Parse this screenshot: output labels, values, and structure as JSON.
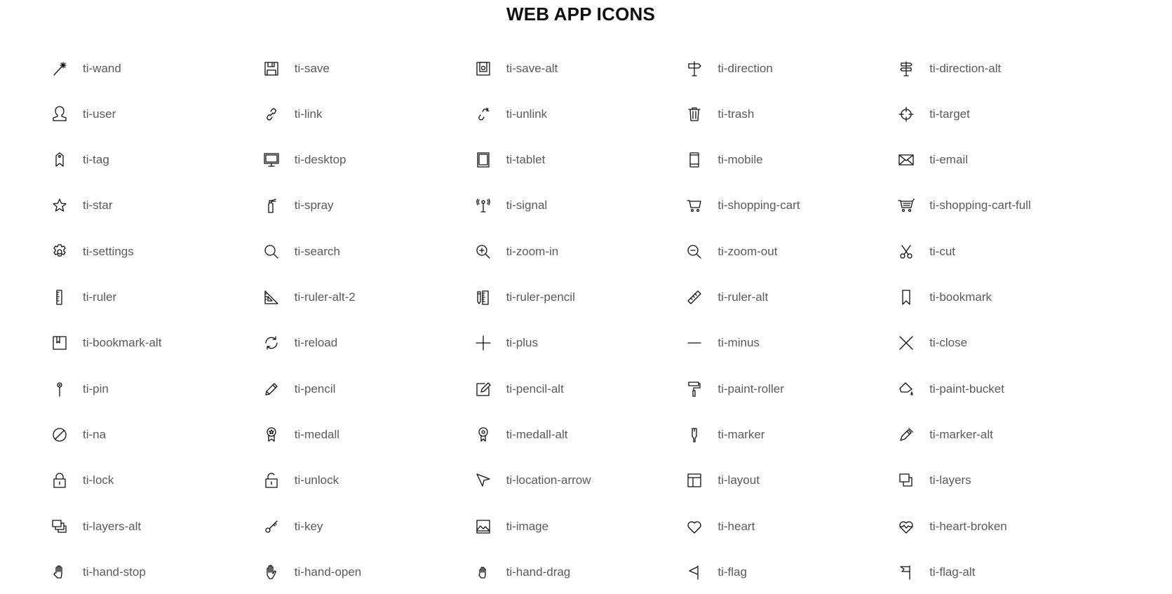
{
  "page": {
    "title": "WEB APP ICONS"
  },
  "icons": [
    {
      "label": "ti-wand",
      "icon": "wand-icon"
    },
    {
      "label": "ti-save",
      "icon": "save-icon"
    },
    {
      "label": "ti-save-alt",
      "icon": "save-alt-icon"
    },
    {
      "label": "ti-direction",
      "icon": "direction-icon"
    },
    {
      "label": "ti-direction-alt",
      "icon": "direction-alt-icon"
    },
    {
      "label": "ti-user",
      "icon": "user-icon"
    },
    {
      "label": "ti-link",
      "icon": "link-icon"
    },
    {
      "label": "ti-unlink",
      "icon": "unlink-icon"
    },
    {
      "label": "ti-trash",
      "icon": "trash-icon"
    },
    {
      "label": "ti-target",
      "icon": "target-icon"
    },
    {
      "label": "ti-tag",
      "icon": "tag-icon"
    },
    {
      "label": "ti-desktop",
      "icon": "desktop-icon"
    },
    {
      "label": "ti-tablet",
      "icon": "tablet-icon"
    },
    {
      "label": "ti-mobile",
      "icon": "mobile-icon"
    },
    {
      "label": "ti-email",
      "icon": "email-icon"
    },
    {
      "label": "ti-star",
      "icon": "star-icon"
    },
    {
      "label": "ti-spray",
      "icon": "spray-icon"
    },
    {
      "label": "ti-signal",
      "icon": "signal-icon"
    },
    {
      "label": "ti-shopping-cart",
      "icon": "shopping-cart-icon"
    },
    {
      "label": "ti-shopping-cart-full",
      "icon": "shopping-cart-full-icon"
    },
    {
      "label": "ti-settings",
      "icon": "settings-icon"
    },
    {
      "label": "ti-search",
      "icon": "search-icon"
    },
    {
      "label": "ti-zoom-in",
      "icon": "zoom-in-icon"
    },
    {
      "label": "ti-zoom-out",
      "icon": "zoom-out-icon"
    },
    {
      "label": "ti-cut",
      "icon": "cut-icon"
    },
    {
      "label": "ti-ruler",
      "icon": "ruler-icon"
    },
    {
      "label": "ti-ruler-alt-2",
      "icon": "ruler-alt-2-icon"
    },
    {
      "label": "ti-ruler-pencil",
      "icon": "ruler-pencil-icon"
    },
    {
      "label": "ti-ruler-alt",
      "icon": "ruler-alt-icon"
    },
    {
      "label": "ti-bookmark",
      "icon": "bookmark-icon"
    },
    {
      "label": "ti-bookmark-alt",
      "icon": "bookmark-alt-icon"
    },
    {
      "label": "ti-reload",
      "icon": "reload-icon"
    },
    {
      "label": "ti-plus",
      "icon": "plus-icon"
    },
    {
      "label": "ti-minus",
      "icon": "minus-icon"
    },
    {
      "label": "ti-close",
      "icon": "close-icon"
    },
    {
      "label": "ti-pin",
      "icon": "pin-icon"
    },
    {
      "label": "ti-pencil",
      "icon": "pencil-icon"
    },
    {
      "label": "ti-pencil-alt",
      "icon": "pencil-alt-icon"
    },
    {
      "label": "ti-paint-roller",
      "icon": "paint-roller-icon"
    },
    {
      "label": "ti-paint-bucket",
      "icon": "paint-bucket-icon"
    },
    {
      "label": "ti-na",
      "icon": "na-icon"
    },
    {
      "label": "ti-medall",
      "icon": "medal-icon"
    },
    {
      "label": "ti-medall-alt",
      "icon": "medal-alt-icon"
    },
    {
      "label": "ti-marker",
      "icon": "marker-icon"
    },
    {
      "label": "ti-marker-alt",
      "icon": "marker-alt-icon"
    },
    {
      "label": "ti-lock",
      "icon": "lock-icon"
    },
    {
      "label": "ti-unlock",
      "icon": "unlock-icon"
    },
    {
      "label": "ti-location-arrow",
      "icon": "location-arrow-icon"
    },
    {
      "label": "ti-layout",
      "icon": "layout-icon"
    },
    {
      "label": "ti-layers",
      "icon": "layers-icon"
    },
    {
      "label": "ti-layers-alt",
      "icon": "layers-alt-icon"
    },
    {
      "label": "ti-key",
      "icon": "key-icon"
    },
    {
      "label": "ti-image",
      "icon": "image-icon"
    },
    {
      "label": "ti-heart",
      "icon": "heart-icon"
    },
    {
      "label": "ti-heart-broken",
      "icon": "heart-broken-icon"
    },
    {
      "label": "ti-hand-stop",
      "icon": "hand-stop-icon"
    },
    {
      "label": "ti-hand-open",
      "icon": "hand-open-icon"
    },
    {
      "label": "ti-hand-drag",
      "icon": "hand-drag-icon"
    },
    {
      "label": "ti-flag",
      "icon": "flag-icon"
    },
    {
      "label": "ti-flag-alt",
      "icon": "flag-alt-icon"
    }
  ]
}
